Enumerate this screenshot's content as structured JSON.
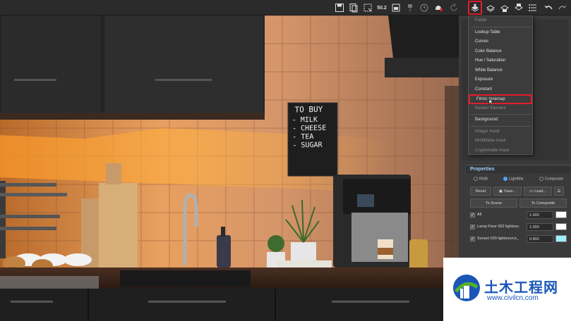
{
  "dropdown": {
    "items": [
      {
        "label": "Folder",
        "disabled": true
      },
      {
        "label": "Lookup Table",
        "disabled": false
      },
      {
        "label": "Curves",
        "disabled": false
      },
      {
        "label": "Color Balance",
        "disabled": false
      },
      {
        "label": "Hue / Saturation",
        "disabled": false
      },
      {
        "label": "White Balance",
        "disabled": false
      },
      {
        "label": "Exposure",
        "disabled": false
      },
      {
        "label": "Constant",
        "disabled": false
      },
      {
        "label": "Filmic tonemap",
        "disabled": false,
        "highlighted": true
      },
      {
        "label": "Render Element",
        "disabled": true
      },
      {
        "label": "Background",
        "disabled": false
      },
      {
        "label": "Integer mask",
        "disabled": true
      },
      {
        "label": "MultiMatte mask",
        "disabled": true
      },
      {
        "label": "Cryptomatte mask",
        "disabled": true
      }
    ]
  },
  "properties": {
    "title": "Properties",
    "modes": [
      {
        "label": "RGB",
        "selected": false
      },
      {
        "label": "LightMix",
        "selected": true
      },
      {
        "label": "Composite",
        "selected": false
      }
    ],
    "reset_label": "Reset",
    "save_label": "Save...",
    "load_label": "Load...",
    "to_scene_label": "To Scene",
    "to_composite_label": "To Composite",
    "lights": [
      {
        "name": "All",
        "value": "1.000",
        "color": "#ffffff"
      },
      {
        "name": "Lamp Floor 002 lightsou",
        "value": "1.000",
        "color": "#ffffff"
      },
      {
        "name": "Sunset 020 lightsource_",
        "value": "0.800",
        "color": "#9ef0ff"
      }
    ]
  },
  "chalkboard": {
    "title": "TO BUY",
    "items": [
      "- MILK",
      "- CHEESE",
      "- TEA",
      "- SUGAR"
    ]
  },
  "watermark": {
    "brand": "土木工程网",
    "url": "www.civilcn.com"
  },
  "colors": {
    "highlight": "#e11d2b",
    "accent": "#4ea5ff",
    "watermark_blue": "#1a56b8",
    "watermark_green": "#56b02b"
  }
}
